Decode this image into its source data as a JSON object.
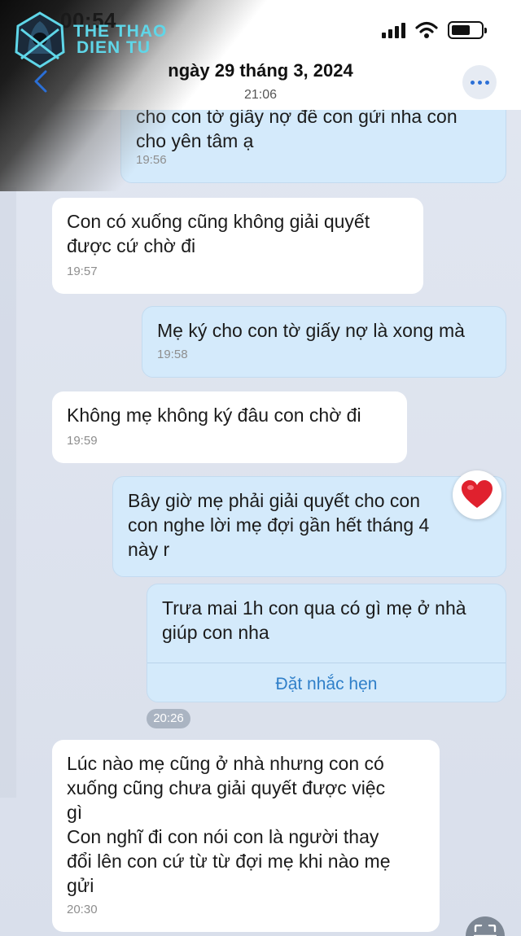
{
  "status_bar": {
    "time": "00:54"
  },
  "logo": {
    "line1": "THE THAO",
    "line2": "DIEN TU"
  },
  "header": {
    "title": "ngày 29 tháng 3, 2024",
    "subtitle": "21:06"
  },
  "messages": [
    {
      "text": "cho con tờ giấy nợ để con gửi nha con\ncho yên tâm ạ",
      "time": "19:56"
    },
    {
      "text": "Con có xuống cũng không giải quyết\nđược cứ chờ đi",
      "time": "19:57"
    },
    {
      "text": "Mẹ ký cho con tờ giấy nợ là xong mà",
      "time": "19:58"
    },
    {
      "text": "Không mẹ không ký đâu con chờ đi",
      "time": "19:59"
    },
    {
      "text": "Bây giờ mẹ phải giải quyết cho con\ncon nghe lời mẹ đợi gần hết tháng 4\nnày r"
    },
    {
      "text": "Trưa mai 1h con qua có gì mẹ ở nhà\ngiúp con nha",
      "action": "Đặt nhắc hẹn",
      "time": "20:26"
    },
    {
      "text": "Lúc nào mẹ cũng ở nhà nhưng con có\nxuống cũng chưa giải quyết được việc\ngì\nCon nghĩ đi con nói con là người thay\nđổi lên con cứ từ từ đợi mẹ khi nào mẹ\ngửi",
      "time": "20:30"
    }
  ],
  "colors": {
    "incoming": "#ffffff",
    "outgoing": "#d4eafb",
    "accent": "#2f7fc9",
    "reaction": "#e0212e"
  },
  "icons": {
    "back": "chevron-left-icon",
    "more": "more-icon",
    "reaction": "heart-icon",
    "scan": "scan-icon"
  }
}
